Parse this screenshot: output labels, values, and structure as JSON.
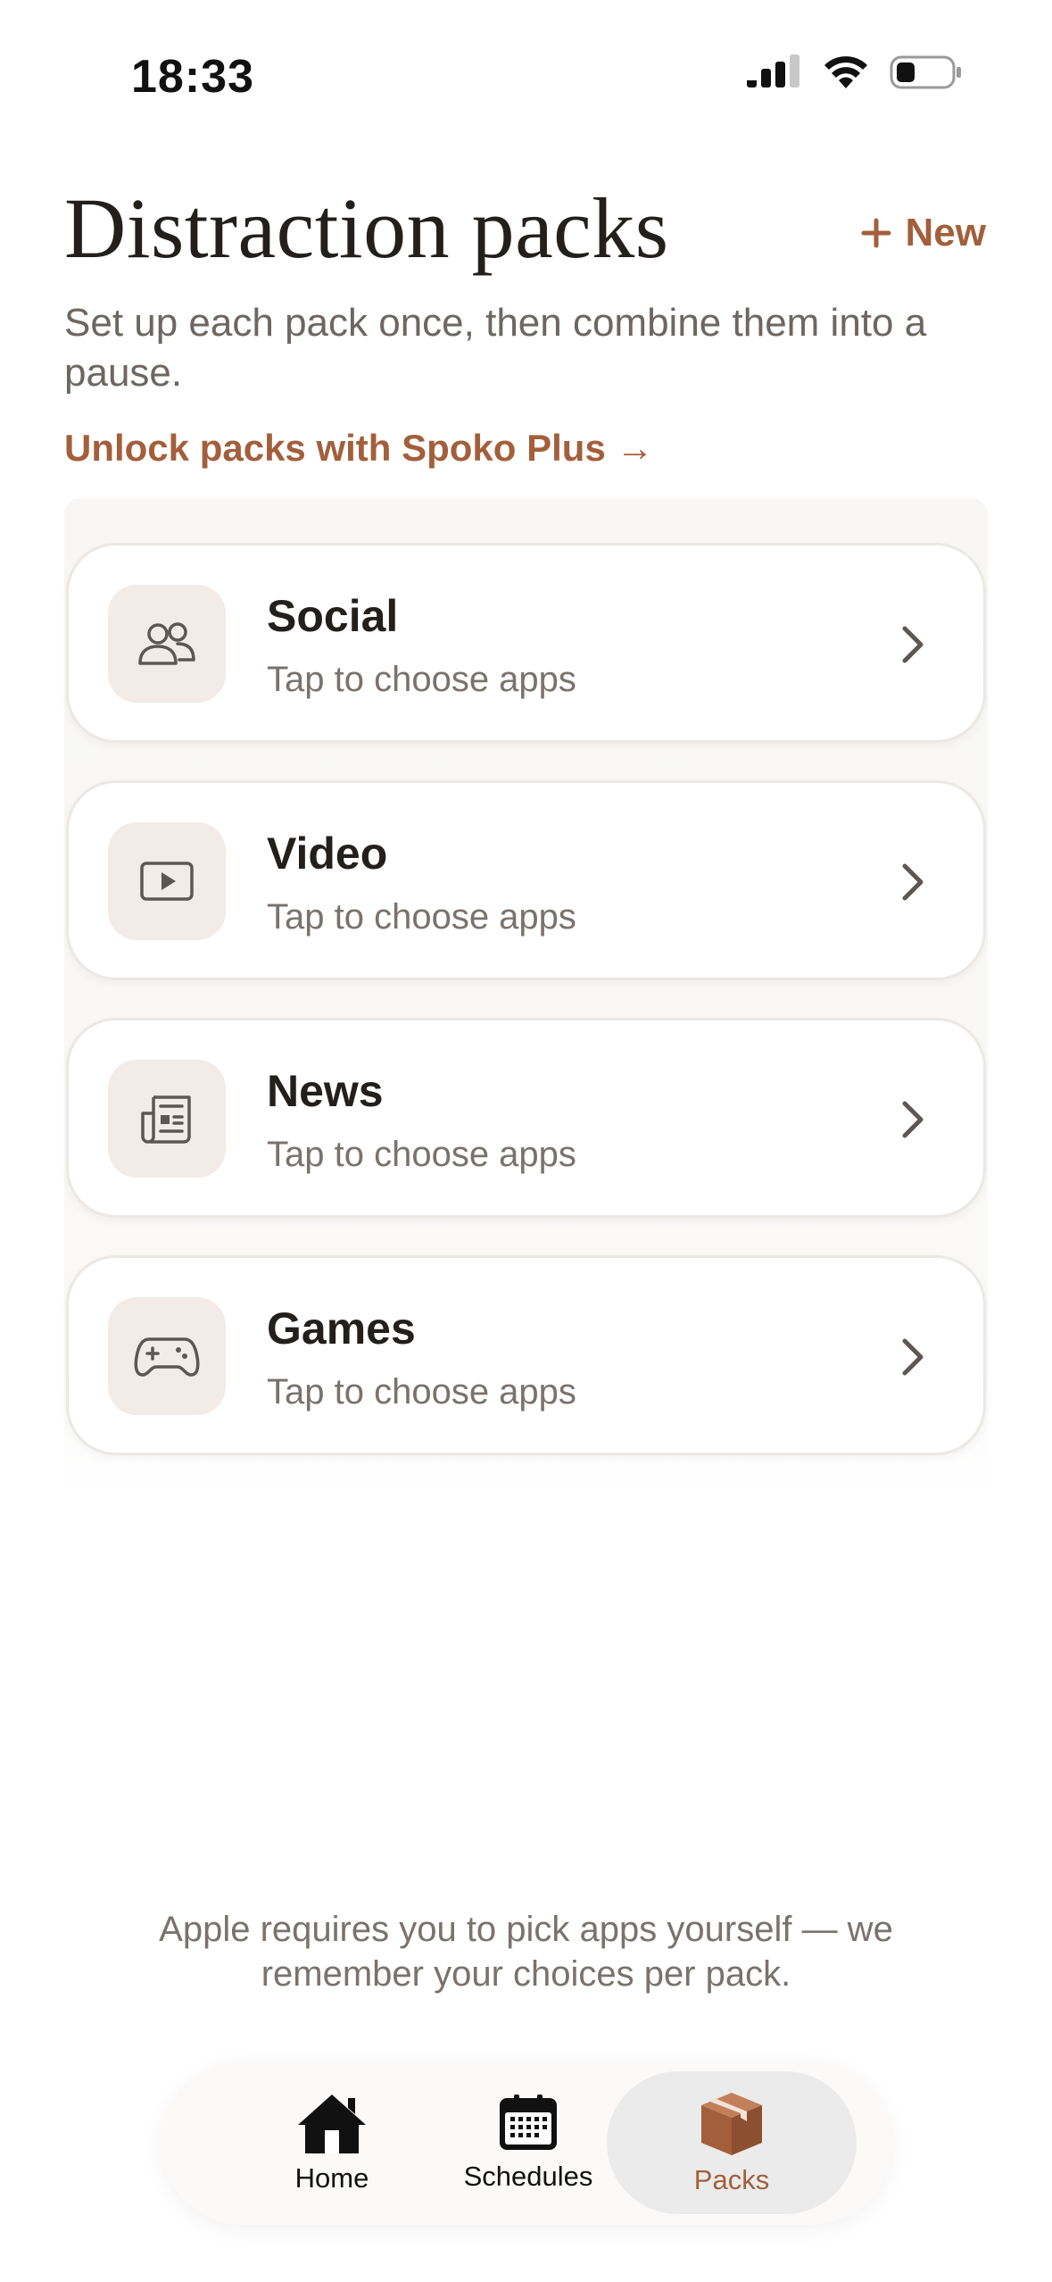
{
  "status_bar": {
    "time": "18:33"
  },
  "header": {
    "title": "Distraction packs",
    "new_button_label": "New",
    "subtitle": "Set up each pack once, then combine them into a pause.",
    "unlock_link": "Unlock packs with Spoko Plus →"
  },
  "packs": [
    {
      "name": "Social",
      "subtitle": "Tap to choose apps",
      "icon": "people-icon"
    },
    {
      "name": "Video",
      "subtitle": "Tap to choose apps",
      "icon": "play-icon"
    },
    {
      "name": "News",
      "subtitle": "Tap to choose apps",
      "icon": "newspaper-icon"
    },
    {
      "name": "Games",
      "subtitle": "Tap to choose apps",
      "icon": "gamepad-icon"
    }
  ],
  "footer_note": "Apple requires you to pick apps yourself — we remember your choices per pack.",
  "tabs": [
    {
      "label": "Home",
      "icon": "house-icon",
      "active": false
    },
    {
      "label": "Schedules",
      "icon": "calendar-icon",
      "active": false
    },
    {
      "label": "Packs",
      "icon": "box-icon",
      "active": true
    }
  ],
  "colors": {
    "accent": "#a35f3b",
    "icon_tile": "#f3ebe7",
    "active_tab": "#ebebeb"
  }
}
